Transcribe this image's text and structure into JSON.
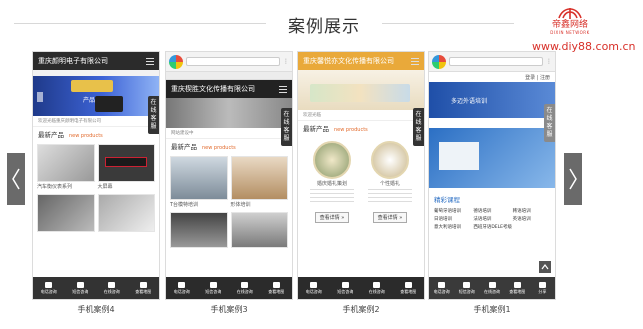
{
  "header": {
    "title": "案例展示",
    "logo_text": "帝鑫网络",
    "logo_sub": "DIXIN NETWORK",
    "site_url": "www.diy88.com.cn"
  },
  "nav": {
    "prev_icon": "chevron-left-icon",
    "next_icon": "chevron-right-icon"
  },
  "colors": {
    "accent": "#d8312a",
    "arrow_bg": "#6a6a6a",
    "section_en": "#e26a2c"
  },
  "cards": [
    {
      "caption": "手机案例4",
      "site_title": "重庆颜明电子有限公司",
      "banner_tagline": "产品展示",
      "notice": "欢迎光临重庆颜明电子有限公司",
      "section_cn": "最新产品",
      "section_en": "new products",
      "product_labels": [
        "汽车衡仪表系列",
        "大屏幕"
      ],
      "side_tab": "在线客服",
      "footer": [
        "电话咨询",
        "短信咨询",
        "在线咨询",
        "查看地图"
      ]
    },
    {
      "caption": "手机案例3",
      "site_title": "重庆楔胜文化传播有限公司",
      "notice": "网站建设中",
      "section_cn": "最新产品",
      "section_en": "new products",
      "product_labels": [
        "T台模特培训",
        "形体培训"
      ],
      "side_tab": "在线客服",
      "footer": [
        "电话咨询",
        "短信咨询",
        "在线咨询",
        "查看地图"
      ]
    },
    {
      "caption": "手机案例2",
      "site_title": "重庆馨悦亦文化传播有限公司",
      "notice": "欢迎光临",
      "section_cn": "最新产品",
      "section_en": "new products",
      "product_labels": [
        "婚庆婚礼策划",
        "个性婚礼"
      ],
      "detail_button": "查看详情 »",
      "side_tab": "在线客服",
      "footer": [
        "电话咨询",
        "短信咨询",
        "在线咨询",
        "查看地图"
      ]
    },
    {
      "caption": "手机案例1",
      "login_text": "登录 | 注册",
      "banner_tagline": "多迈外语培训",
      "section_cn": "精彩课程",
      "courses": [
        "葡萄牙语培训",
        "德语培训",
        "韩语培训",
        "日语培训",
        "法语培训",
        "英语培训",
        "意大利语培训",
        "西班牙语DELE考级"
      ],
      "side_tab": "在线客服",
      "footer": [
        "电话咨询",
        "短信咨询",
        "在线咨询",
        "查看地图",
        "分享"
      ]
    }
  ]
}
